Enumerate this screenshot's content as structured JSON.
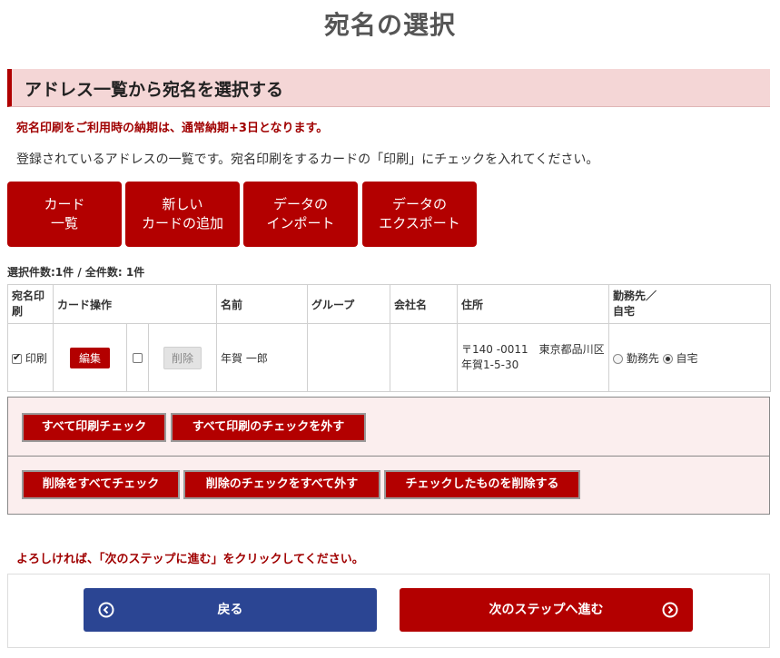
{
  "page_title": "宛名の選択",
  "section_title": "アドレス一覧から宛名を選択する",
  "notice": "宛名印刷をご利用時の納期は、通常納期+3日となります。",
  "description": "登録されているアドレスの一覧です。宛名印刷をするカードの「印刷」にチェックを入れてください。",
  "nav_buttons": [
    {
      "line1": "カード",
      "line2": "一覧"
    },
    {
      "line1": "新しい",
      "line2": "カードの追加"
    },
    {
      "line1": "データの",
      "line2": "インポート"
    },
    {
      "line1": "データの",
      "line2": "エクスポート"
    }
  ],
  "counts": "選択件数:1件 / 全件数: 1件",
  "table": {
    "headers": {
      "print_line1": "宛名印",
      "print_line2": "刷",
      "card_ops": "カード操作",
      "name": "名前",
      "group": "グループ",
      "company": "会社名",
      "address": "住所",
      "dest_line1": "勤務先／",
      "dest_line2": "自宅"
    },
    "rows": [
      {
        "print_checked": true,
        "print_label": "印刷",
        "edit_label": "編集",
        "delete_checked": false,
        "delete_label": "削除",
        "name": "年賀 一郎",
        "group": "",
        "company": "",
        "address": "〒140 -0011　東京都品川区年賀1-5-30",
        "dest_work_label": "勤務先",
        "dest_home_label": "自宅",
        "dest_selected": "自宅"
      }
    ]
  },
  "bulk_actions": {
    "print_check_all": "すべて印刷チェック",
    "print_uncheck_all": "すべて印刷のチェックを外す",
    "delete_check_all": "削除をすべてチェック",
    "delete_uncheck_all": "削除のチェックをすべて外す",
    "delete_checked": "チェックしたものを削除する"
  },
  "confirm_message": "よろしければ、「次のステップに進む」をクリックしてください。",
  "footer": {
    "back_label": "戻る",
    "next_label": "次のステップへ進む"
  },
  "colors": {
    "accent_red": "#b30000",
    "back_blue": "#2b4593",
    "section_bg": "#f4d6d6",
    "bulk_bg": "#fbeeee"
  },
  "icons": {
    "back": "circle-chevron-left-icon",
    "next": "circle-chevron-right-icon"
  }
}
